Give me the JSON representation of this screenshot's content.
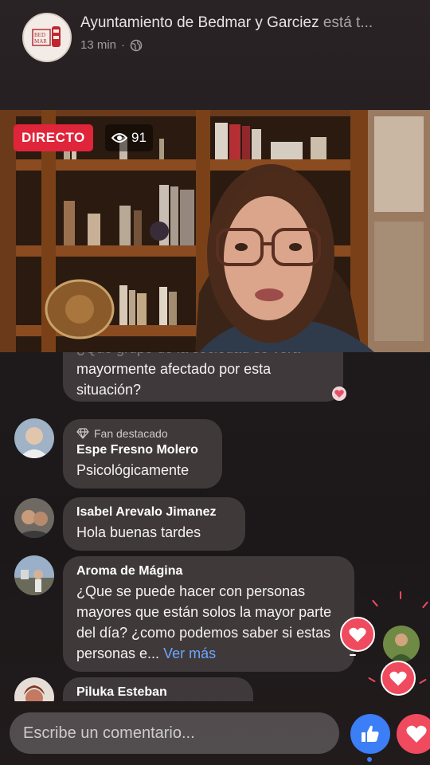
{
  "header": {
    "page_name": "Ayuntamiento de Bedmar y Garciez",
    "status_suffix": "está t...",
    "time_ago": "13 min",
    "avatar_text": "BED MAR"
  },
  "live": {
    "badge": "DIRECTO",
    "viewers": "91"
  },
  "comments": [
    {
      "name": "",
      "text_line_cut": "¿Que grupo de la sociedad se verá",
      "text": "mayormente afectado por esta situación?"
    },
    {
      "badge": "Fan destacado",
      "name": "Espe Fresno Molero",
      "text": "Psicológicamente"
    },
    {
      "name": "Isabel Arevalo Jimanez",
      "text": "Hola buenas tardes"
    },
    {
      "name": "Aroma de Mágina",
      "text": "¿Que se puede hacer con personas mayores que están solos la mayor parte del día? ¿como podemos saber si estas personas e...",
      "more": "Ver más"
    },
    {
      "name": "Piluka Esteban",
      "text": ""
    }
  ],
  "composer": {
    "placeholder": "Escribe un comentario..."
  },
  "colors": {
    "live_red": "#e0253a",
    "like_blue": "#3b7ef5",
    "love_red": "#ef4a5e",
    "link_blue": "#6ba6ff"
  },
  "icons": {
    "viewers": "eye-icon",
    "privacy": "globe-icon",
    "fan": "diamond-icon",
    "like": "thumbs-up-icon",
    "love": "heart-icon"
  }
}
